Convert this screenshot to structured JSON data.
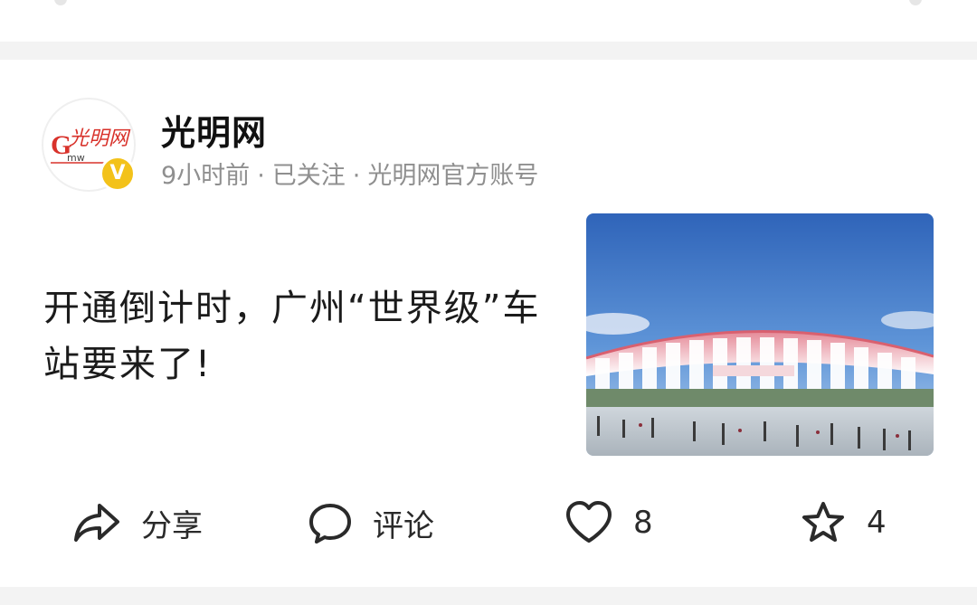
{
  "author": {
    "name": "光明网",
    "avatar_logo_text": "光明网",
    "avatar_logo_latin": "Gmw.cn",
    "verified_badge": "V"
  },
  "meta": {
    "time": "9小时前",
    "follow_status": "已关注",
    "account_type": "光明网官方账号",
    "separator": "·"
  },
  "post": {
    "title": "开通倒计时，广州“世界级”车站要来了!",
    "thumbnail_icon": "stadium-photo"
  },
  "actions": {
    "share_label": "分享",
    "comment_label": "评论",
    "like_count": "8",
    "favorite_count": "4"
  },
  "colors": {
    "accent_red": "#d8322b",
    "verified_yellow": "#f3c21a",
    "meta_gray": "#8f8f8f"
  }
}
